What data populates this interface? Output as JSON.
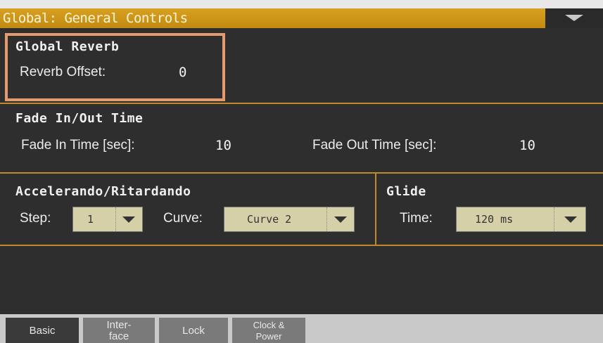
{
  "header": {
    "title": "Global: General Controls",
    "menu_icon": "chevron-down-icon"
  },
  "global_reverb": {
    "title": "Global Reverb",
    "reverb_offset_label": "Reverb Offset:",
    "reverb_offset_value": "0"
  },
  "fade": {
    "title": "Fade In/Out Time",
    "fade_in_label": "Fade In Time [sec]:",
    "fade_in_value": "10",
    "fade_out_label": "Fade Out Time [sec]:",
    "fade_out_value": "10"
  },
  "accel": {
    "title": "Accelerando/Ritardando",
    "step_label": "Step:",
    "step_value": "1",
    "curve_label": "Curve:",
    "curve_value": "Curve 2"
  },
  "glide": {
    "title": "Glide",
    "time_label": "Time:",
    "time_value": "120 ms"
  },
  "tabs": [
    {
      "line1": "Basic",
      "line2": ""
    },
    {
      "line1": "Inter-",
      "line2": "face"
    },
    {
      "line1": "Lock",
      "line2": ""
    },
    {
      "line1": "Clock &",
      "line2": "Power"
    }
  ],
  "colors": {
    "accent": "#c38a12",
    "border": "#c08a2a",
    "highlight": "#e39a6d",
    "field": "#d6d0a8"
  }
}
